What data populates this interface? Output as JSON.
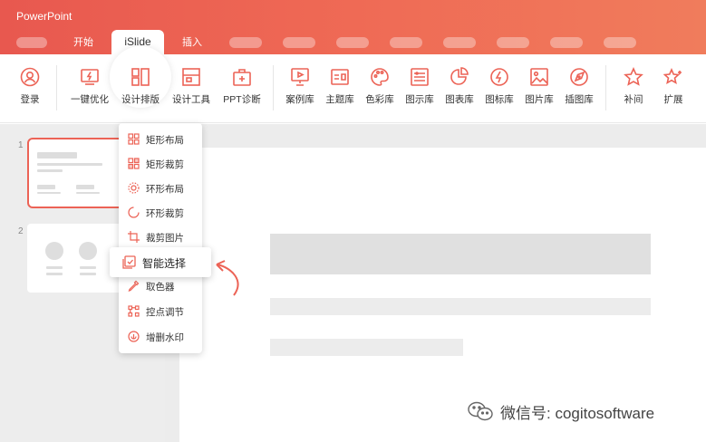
{
  "app": {
    "title": "PowerPoint"
  },
  "tabs": [
    {
      "label": "开始"
    },
    {
      "label": "iSlide",
      "active": true
    },
    {
      "label": "插入"
    }
  ],
  "ribbon": {
    "buttons": [
      {
        "label": "登录",
        "icon": "user-icon"
      },
      {
        "label": "一键优化",
        "icon": "lightning-monitor-icon"
      },
      {
        "label": "设计排版",
        "icon": "layout-icon"
      },
      {
        "label": "设计工具",
        "icon": "design-tool-icon"
      },
      {
        "label": "PPT诊断",
        "icon": "medical-kit-icon"
      },
      {
        "label": "案例库",
        "icon": "presentation-icon"
      },
      {
        "label": "主题库",
        "icon": "theme-icon"
      },
      {
        "label": "色彩库",
        "icon": "palette-icon"
      },
      {
        "label": "图示库",
        "icon": "diagram-icon"
      },
      {
        "label": "图表库",
        "icon": "pie-chart-icon"
      },
      {
        "label": "图标库",
        "icon": "bolt-icon"
      },
      {
        "label": "图片库",
        "icon": "image-icon"
      },
      {
        "label": "插图库",
        "icon": "compass-icon"
      },
      {
        "label": "补间",
        "icon": "star-icon"
      },
      {
        "label": "扩展",
        "icon": "star-sparkle-icon"
      }
    ]
  },
  "slides": {
    "numbers": [
      "1",
      "2"
    ]
  },
  "dropdown": {
    "items": [
      {
        "label": "矩形布局",
        "icon": "grid-icon"
      },
      {
        "label": "矩形裁剪",
        "icon": "grid-crop-icon"
      },
      {
        "label": "环形布局",
        "icon": "ring-layout-icon"
      },
      {
        "label": "环形裁剪",
        "icon": "ring-crop-icon"
      },
      {
        "label": "裁剪图片",
        "icon": "crop-icon"
      },
      {
        "label": "智能选择",
        "icon": "smart-select-icon",
        "selected": true
      },
      {
        "label": "取色器",
        "icon": "eyedropper-icon"
      },
      {
        "label": "控点调节",
        "icon": "control-points-icon"
      },
      {
        "label": "增删水印",
        "icon": "watermark-icon"
      }
    ]
  },
  "watermark": {
    "text": "微信号: cogitosoftware"
  },
  "colors": {
    "accent": "#ec6356",
    "titlebar_start": "#e8584f",
    "titlebar_end": "#f07c5c"
  }
}
